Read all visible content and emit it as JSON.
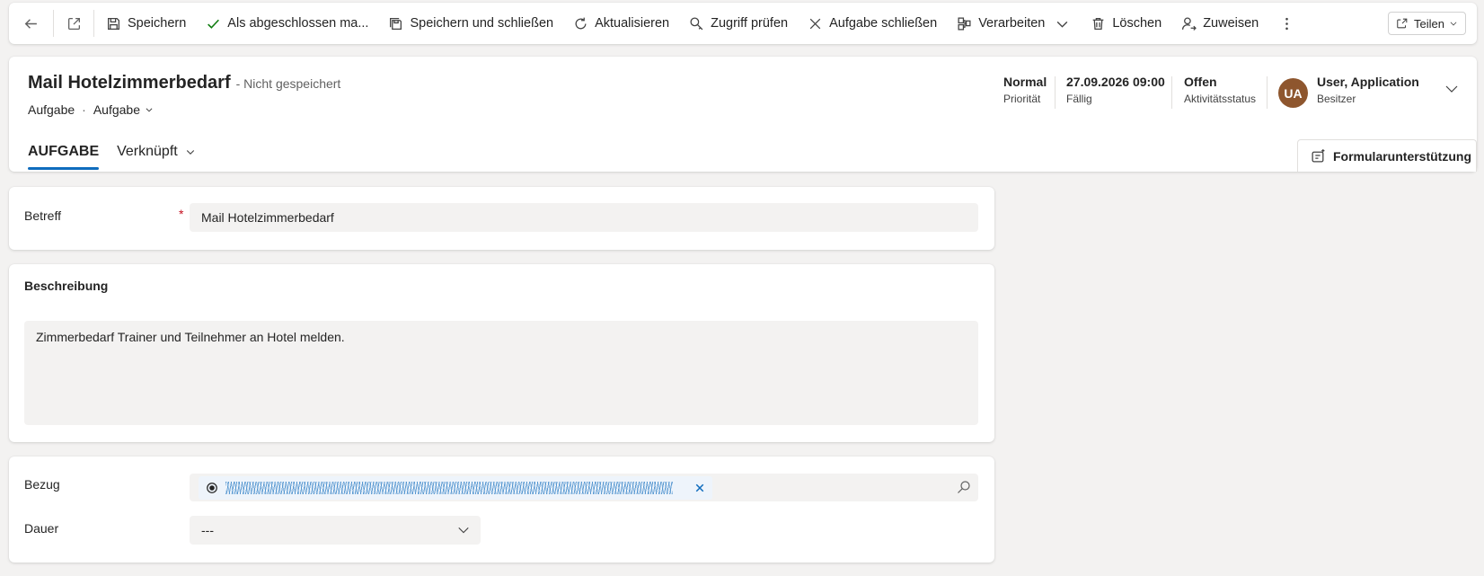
{
  "toolbar": {
    "save": "Speichern",
    "mark_complete": "Als abgeschlossen ma...",
    "save_close": "Speichern und schließen",
    "refresh": "Aktualisieren",
    "check_access": "Zugriff prüfen",
    "close_task": "Aufgabe schließen",
    "process": "Verarbeiten",
    "delete": "Löschen",
    "assign": "Zuweisen",
    "share": "Teilen"
  },
  "header": {
    "title": "Mail Hotelzimmerbedarf",
    "save_status": "- Nicht gespeichert",
    "entity": "Aufgabe",
    "form_selector": "Aufgabe",
    "priority_value": "Normal",
    "priority_label": "Priorität",
    "due_value": "27.09.2026 09:00",
    "due_label": "Fällig",
    "status_value": "Offen",
    "status_label": "Aktivitätsstatus",
    "owner_initials": "UA",
    "owner_name": "User, Application",
    "owner_label": "Besitzer",
    "avatar_color": "#8e562e"
  },
  "tabs": {
    "task": "AUFGABE",
    "related": "Verknüpft"
  },
  "form_assist": "Formularunterstützung",
  "form": {
    "subject_label": "Betreff",
    "required_marker": "*",
    "subject_value": "Mail Hotelzimmerbedarf",
    "description_title": "Beschreibung",
    "description_value": "Zimmerbedarf Trainer und Teilnehmer an Hotel melden.",
    "regarding_label": "Bezug",
    "duration_label": "Dauer",
    "duration_value": "---"
  },
  "colors": {
    "accent": "#0f6cbd",
    "required": "#c50f1f",
    "check": "#107c10"
  }
}
